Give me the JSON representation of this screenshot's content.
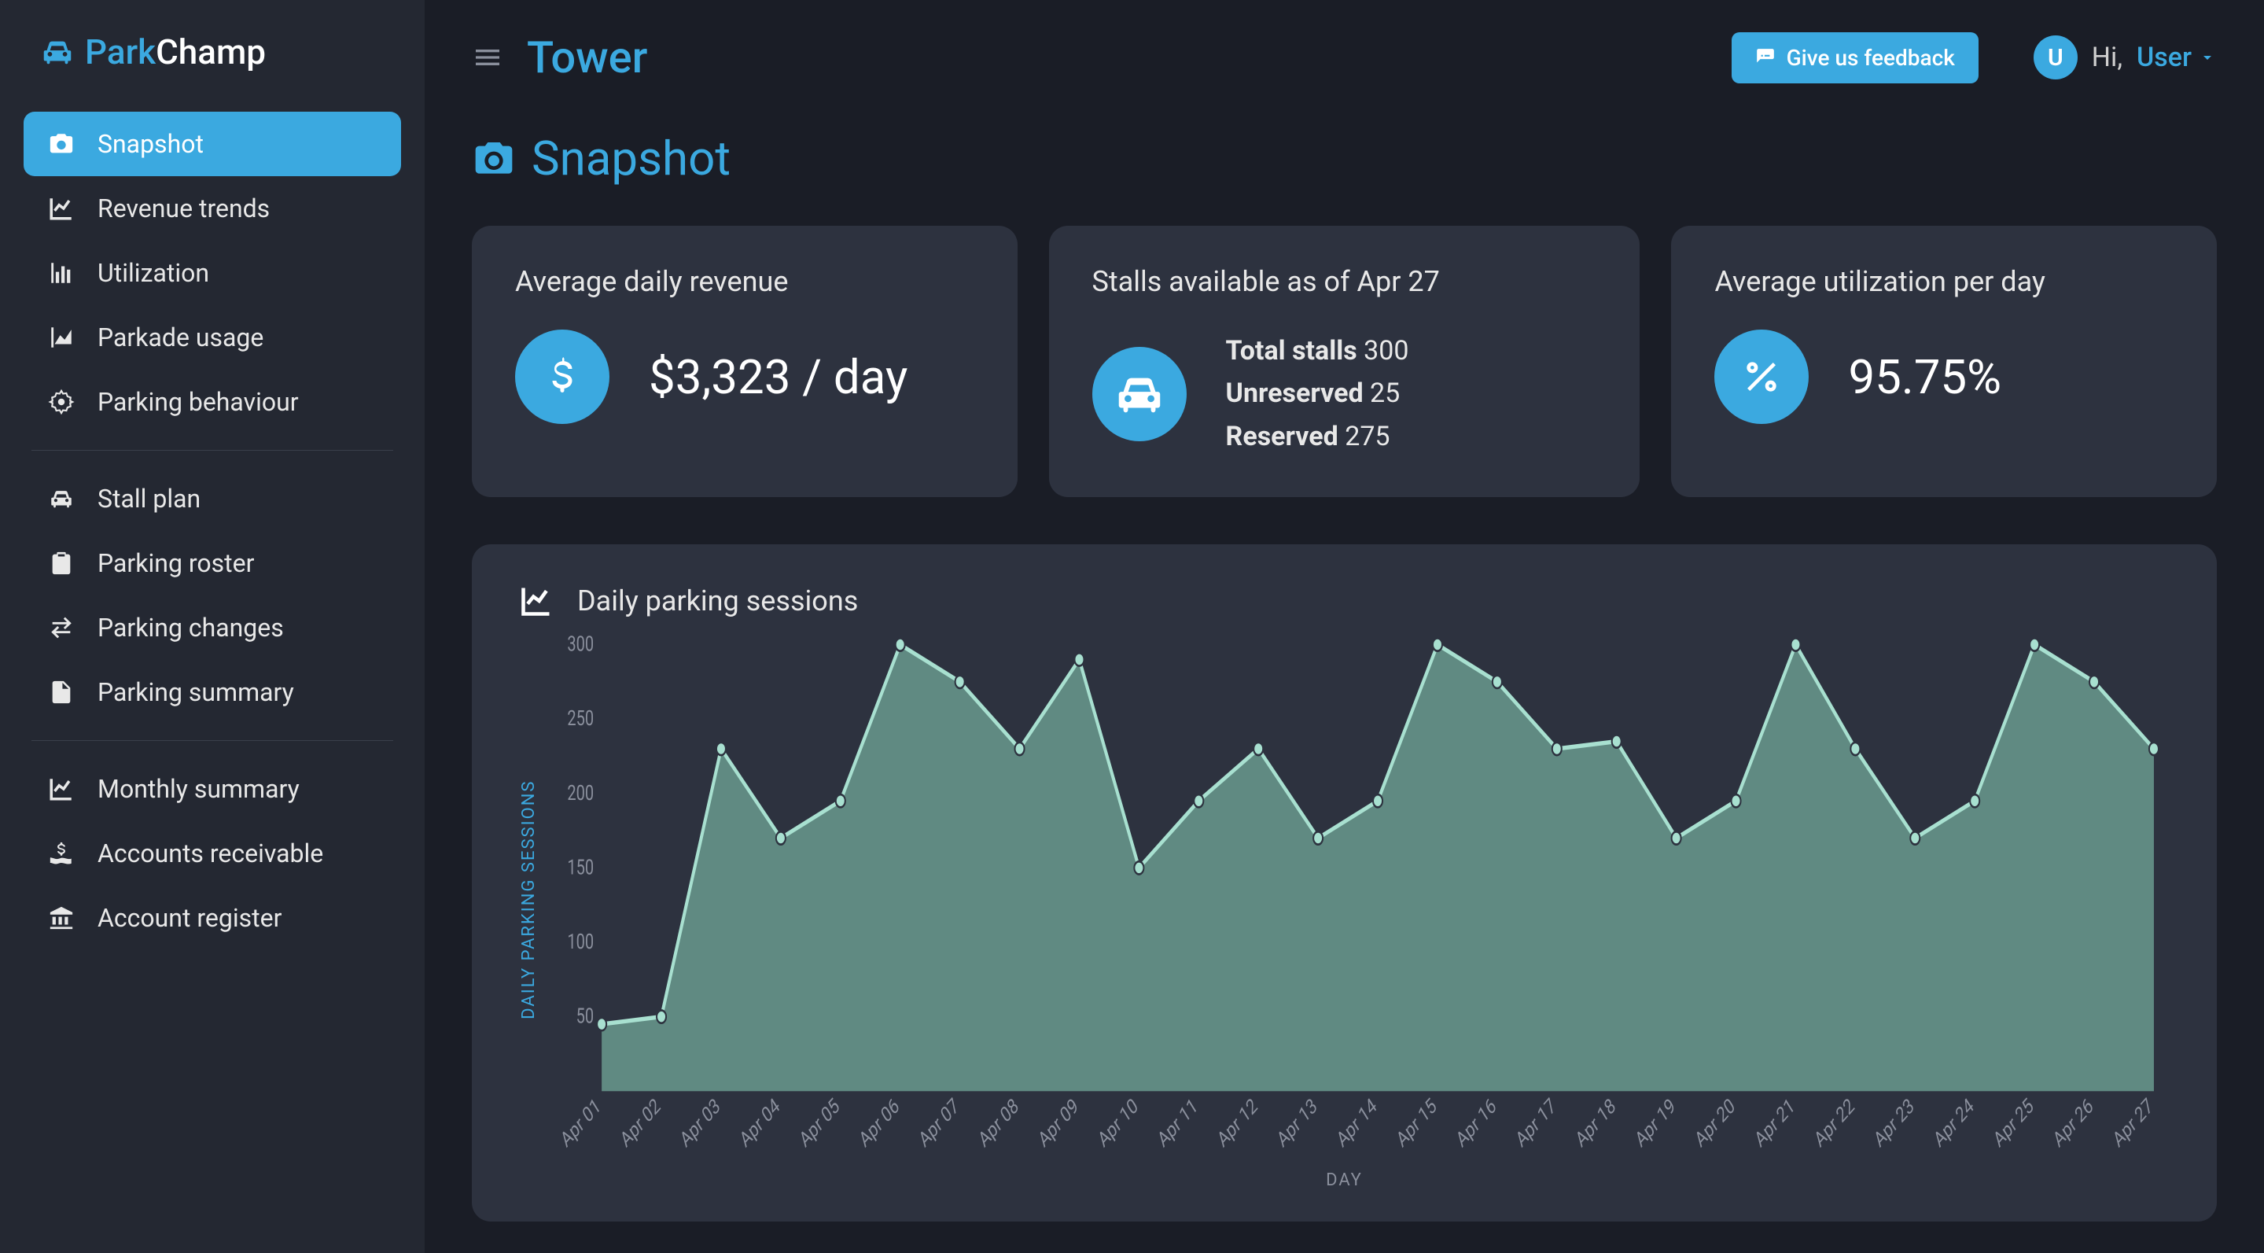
{
  "brand": {
    "prefix": "Park",
    "suffix": "Champ"
  },
  "sidebar": {
    "items": [
      {
        "label": "Snapshot",
        "icon": "camera",
        "active": true
      },
      {
        "label": "Revenue trends",
        "icon": "line-chart"
      },
      {
        "label": "Utilization",
        "icon": "bar-chart"
      },
      {
        "label": "Parkade usage",
        "icon": "area-chart"
      },
      {
        "label": "Parking behaviour",
        "icon": "gear-head"
      },
      {
        "divider": true
      },
      {
        "label": "Stall plan",
        "icon": "car"
      },
      {
        "label": "Parking roster",
        "icon": "clipboard"
      },
      {
        "label": "Parking changes",
        "icon": "swap"
      },
      {
        "label": "Parking summary",
        "icon": "document"
      },
      {
        "divider": true
      },
      {
        "label": "Monthly summary",
        "icon": "line-chart"
      },
      {
        "label": "Accounts receivable",
        "icon": "hand-money"
      },
      {
        "label": "Account register",
        "icon": "bank"
      }
    ]
  },
  "topbar": {
    "title": "Tower",
    "feedback_label": "Give us feedback",
    "greeting": "Hi,",
    "user_name": "User",
    "user_initial": "U"
  },
  "page": {
    "title": "Snapshot"
  },
  "cards": {
    "revenue": {
      "title": "Average daily revenue",
      "value": "$3,323 / day"
    },
    "stalls": {
      "title": "Stalls available as of Apr 27",
      "total_label": "Total stalls",
      "total_value": "300",
      "unreserved_label": "Unreserved",
      "unreserved_value": "25",
      "reserved_label": "Reserved",
      "reserved_value": "275"
    },
    "utilization": {
      "title": "Average utilization per day",
      "value": "95.75%"
    }
  },
  "chart": {
    "title": "Daily parking sessions",
    "ylabel": "DAILY PARKING SESSIONS",
    "xlabel": "DAY"
  },
  "chart_data": {
    "type": "area",
    "title": "Daily parking sessions",
    "xlabel": "DAY",
    "ylabel": "DAILY PARKING SESSIONS",
    "ylim": [
      0,
      300
    ],
    "yticks": [
      50,
      100,
      150,
      200,
      250,
      300
    ],
    "categories": [
      "Apr 01",
      "Apr 02",
      "Apr 03",
      "Apr 04",
      "Apr 05",
      "Apr 06",
      "Apr 07",
      "Apr 08",
      "Apr 09",
      "Apr 10",
      "Apr 11",
      "Apr 12",
      "Apr 13",
      "Apr 14",
      "Apr 15",
      "Apr 16",
      "Apr 17",
      "Apr 18",
      "Apr 19",
      "Apr 20",
      "Apr 21",
      "Apr 22",
      "Apr 23",
      "Apr 24",
      "Apr 25",
      "Apr 26",
      "Apr 27"
    ],
    "values": [
      45,
      50,
      230,
      170,
      195,
      300,
      275,
      230,
      290,
      150,
      195,
      230,
      170,
      195,
      300,
      275,
      230,
      235,
      170,
      195,
      300,
      230,
      170,
      195,
      300,
      275,
      230
    ]
  }
}
